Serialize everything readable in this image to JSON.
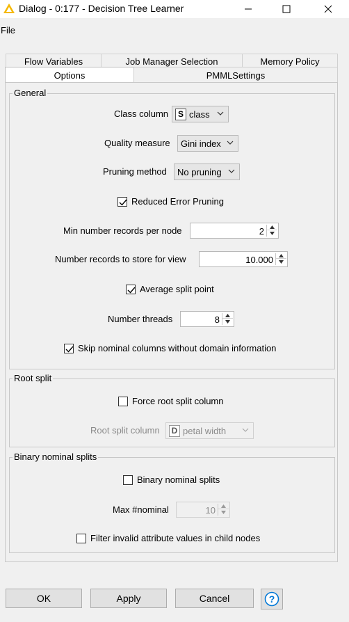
{
  "window": {
    "title": "Dialog - 0:177 - Decision Tree Learner",
    "minimize": "—",
    "maximize": "☐",
    "close": "✕"
  },
  "menu": {
    "file": "File"
  },
  "tabs": {
    "back": [
      "Flow Variables",
      "Job Manager Selection",
      "Memory Policy"
    ],
    "front": [
      "Options",
      "PMMLSettings"
    ],
    "active": "Options"
  },
  "general": {
    "title": "General",
    "class_column_label": "Class column",
    "class_column_type": "S",
    "class_column_value": "class",
    "quality_measure_label": "Quality measure",
    "quality_measure_value": "Gini index",
    "pruning_method_label": "Pruning method",
    "pruning_method_value": "No pruning",
    "reduced_error_pruning_label": "Reduced Error Pruning",
    "reduced_error_pruning_checked": true,
    "min_records_label": "Min number records per node",
    "min_records_value": "2",
    "records_view_label": "Number records to store for view",
    "records_view_value": "10.000",
    "average_split_label": "Average split point",
    "average_split_checked": true,
    "threads_label": "Number threads",
    "threads_value": "8",
    "skip_nominal_label": "Skip nominal columns without domain information",
    "skip_nominal_checked": true
  },
  "root_split": {
    "title": "Root split",
    "force_label": "Force root split column",
    "force_checked": false,
    "column_label": "Root split column",
    "column_type": "D",
    "column_value": "petal width"
  },
  "binary": {
    "title": "Binary nominal splits",
    "binary_label": "Binary nominal splits",
    "binary_checked": false,
    "max_nominal_label": "Max #nominal",
    "max_nominal_value": "10",
    "filter_invalid_label": "Filter invalid attribute values in child nodes",
    "filter_invalid_checked": false
  },
  "buttons": {
    "ok": "OK",
    "apply": "Apply",
    "cancel": "Cancel",
    "help": "?"
  },
  "colors": {
    "accent": "#0078d7",
    "warning_icon": "#f5b800"
  }
}
